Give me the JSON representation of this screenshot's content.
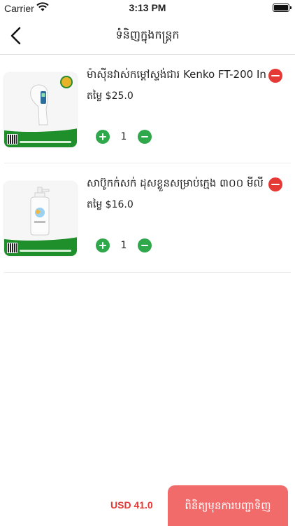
{
  "status_bar": {
    "carrier": "Carrier",
    "time": "3:13 PM"
  },
  "nav": {
    "title": "ទំនិញក្នុងកន្ត្រក"
  },
  "cart": {
    "items": [
      {
        "name": "ម៉ាស៊ីនវាស់កម្ដៅស្ទង់ជារ Kenko FT-200 In",
        "price": "តម្លៃ $25.0",
        "quantity": "1"
      },
      {
        "name": "សាប៊ូកក់សក់ ដុសខ្លួនសម្រាប់ក្មេង ៣០០ មីលី",
        "price": "តម្លៃ $16.0",
        "quantity": "1"
      }
    ]
  },
  "footer": {
    "total": "USD 41.0",
    "checkout_label": "ពិនិត្យមុនការបញ្ជាទិញ"
  },
  "colors": {
    "accent_red": "#e53935",
    "checkout_bg": "#f26b6b",
    "qty_green": "#2ea84a"
  }
}
